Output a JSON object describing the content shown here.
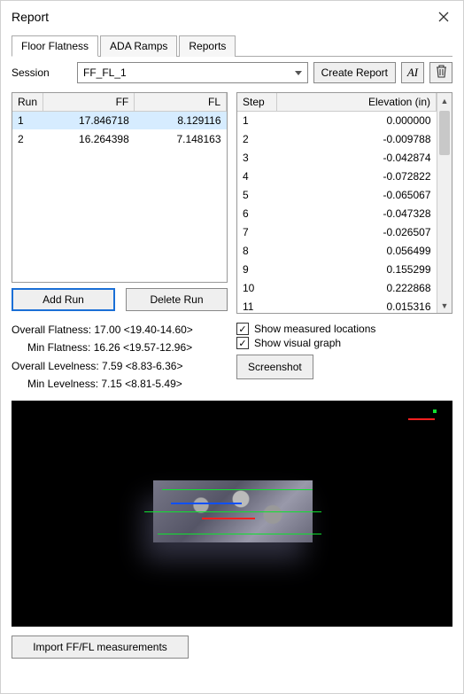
{
  "window": {
    "title": "Report"
  },
  "tabs": {
    "floor_flatness": "Floor Flatness",
    "ada_ramps": "ADA Ramps",
    "reports": "Reports"
  },
  "session": {
    "label": "Session",
    "value": "FF_FL_1"
  },
  "buttons": {
    "create_report": "Create Report",
    "ai": "AI",
    "add_run": "Add Run",
    "delete_run": "Delete Run",
    "screenshot": "Screenshot",
    "import": "Import FF/FL measurements"
  },
  "icons": {
    "trash": "trash-icon",
    "close": "close-icon"
  },
  "runs": {
    "headers": {
      "run": "Run",
      "ff": "FF",
      "fl": "FL"
    },
    "rows": [
      {
        "run": "1",
        "ff": "17.846718",
        "fl": "8.129116",
        "selected": true
      },
      {
        "run": "2",
        "ff": "16.264398",
        "fl": "7.148163",
        "selected": false
      }
    ]
  },
  "steps": {
    "headers": {
      "step": "Step",
      "elev": "Elevation (in)"
    },
    "rows": [
      {
        "step": "1",
        "elev": "0.000000"
      },
      {
        "step": "2",
        "elev": "-0.009788"
      },
      {
        "step": "3",
        "elev": "-0.042874"
      },
      {
        "step": "4",
        "elev": "-0.072822"
      },
      {
        "step": "5",
        "elev": "-0.065067"
      },
      {
        "step": "6",
        "elev": "-0.047328"
      },
      {
        "step": "7",
        "elev": "-0.026507"
      },
      {
        "step": "8",
        "elev": "0.056499"
      },
      {
        "step": "9",
        "elev": "0.155299"
      },
      {
        "step": "10",
        "elev": "0.222868"
      },
      {
        "step": "11",
        "elev": "0.015316"
      }
    ]
  },
  "stats": {
    "overall_flatness": "Overall Flatness: 17.00 <19.40-14.60>",
    "min_flatness": "Min Flatness: 16.26 <19.57-12.96>",
    "overall_levelness": "Overall Levelness: 7.59 <8.83-6.36>",
    "min_levelness": "Min Levelness: 7.15 <8.81-5.49>"
  },
  "checks": {
    "show_measured": "Show measured locations",
    "show_visual": "Show visual graph"
  }
}
